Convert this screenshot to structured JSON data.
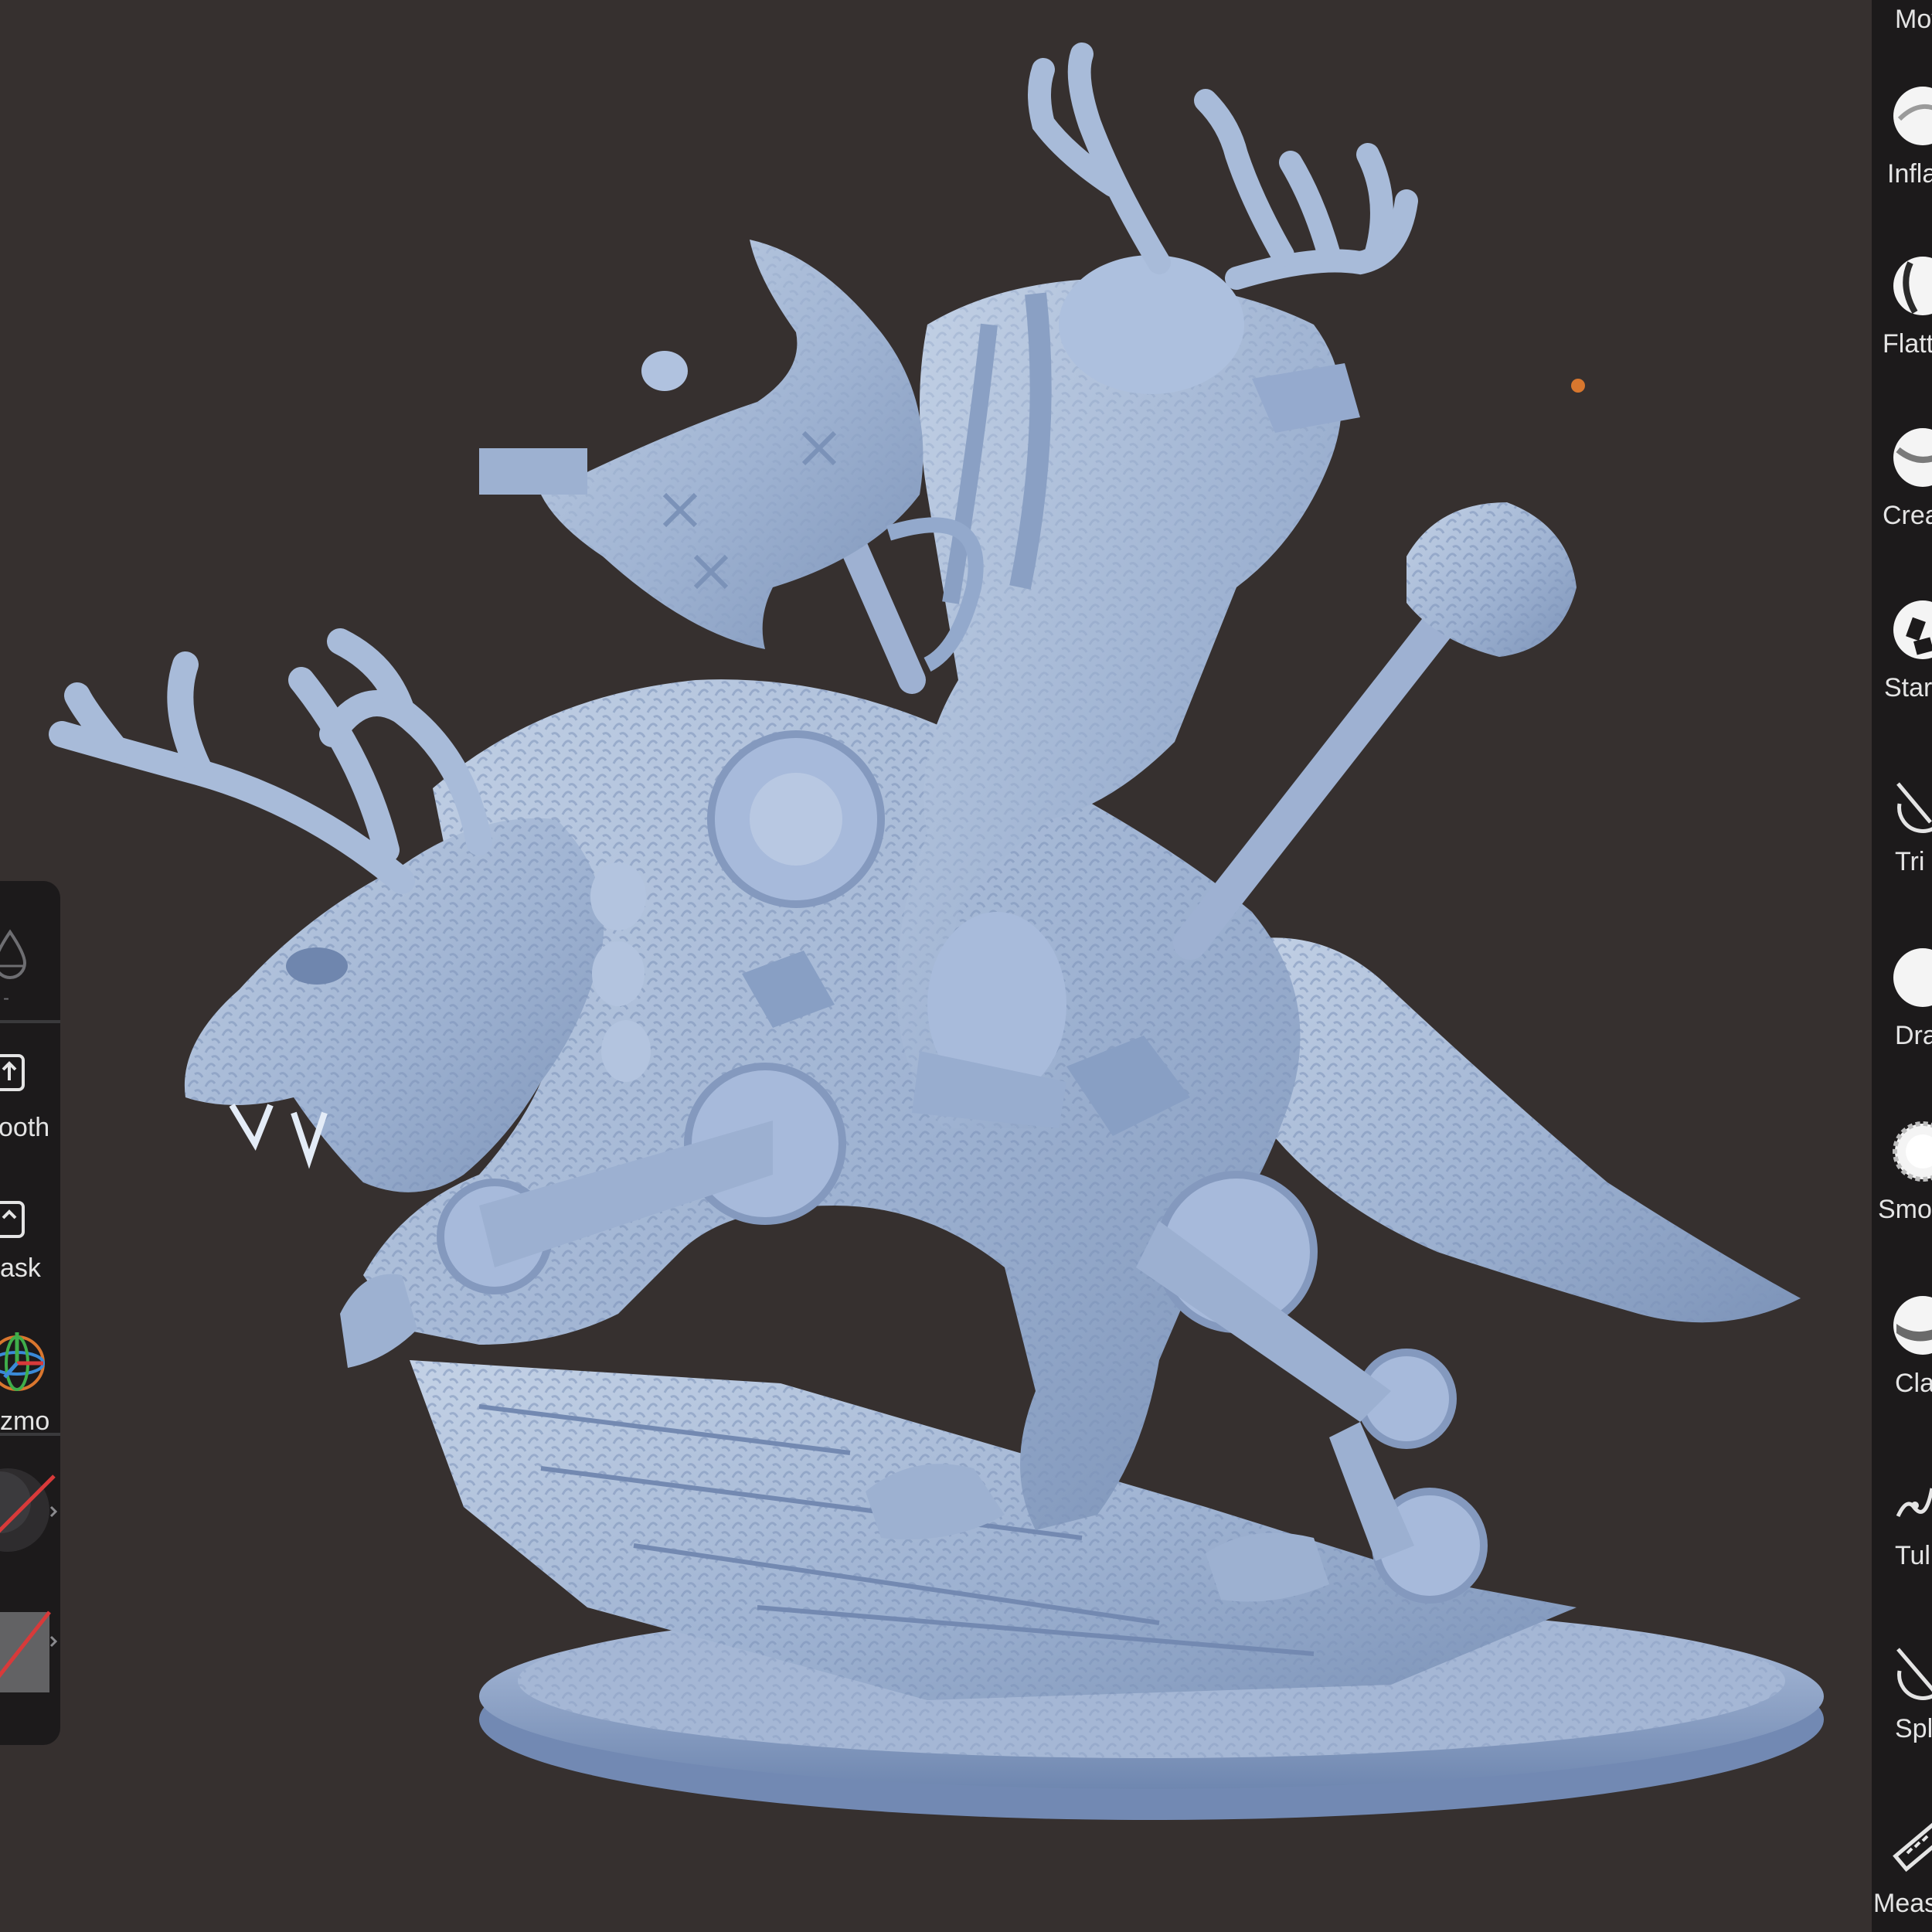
{
  "left_panel": {
    "slot_value": "-",
    "items": [
      {
        "label": "ooth"
      },
      {
        "label": "ask"
      },
      {
        "label": "zmo"
      }
    ]
  },
  "right_toolbar": {
    "tools": [
      {
        "label": "Mov"
      },
      {
        "label": "Infla"
      },
      {
        "label": "Flatt"
      },
      {
        "label": "Crea"
      },
      {
        "label": "Star"
      },
      {
        "label": "Tri"
      },
      {
        "label": "Dra"
      },
      {
        "label": "Smo"
      },
      {
        "label": "Cla"
      },
      {
        "label": "Tul"
      },
      {
        "label": "Spl"
      },
      {
        "label": "Meas"
      }
    ]
  },
  "colors": {
    "background": "#36302f",
    "panel": "#1c1a1b",
    "model": "#a6b9d6",
    "accent_dot": "#d8772e",
    "slash": "#d83a3a"
  }
}
